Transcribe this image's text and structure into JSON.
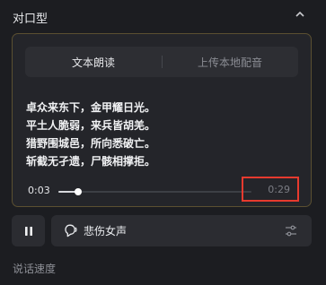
{
  "section": {
    "title": "对口型",
    "collapse_icon": "chevron-up-icon"
  },
  "tabs": [
    {
      "label": "文本朗读",
      "active": true
    },
    {
      "label": "上传本地配音",
      "active": false
    }
  ],
  "poem": {
    "lines": [
      "卓众来东下，金甲耀日光。",
      "平土人脆弱，来兵皆胡羌。",
      "猎野围城邑，所向悉破亡。",
      "斩截无孑遗，尸骸相撑拒。"
    ]
  },
  "player": {
    "current_time": "0:03",
    "total_time": "0:29",
    "progress_fraction": 0.1034
  },
  "controls": {
    "pause_icon": "pause-icon",
    "voice_icon": "voice-speech-icon",
    "voice_label": "悲伤女声",
    "settings_icon": "sliders-icon"
  },
  "footer": {
    "label": "说话速度"
  },
  "colors": {
    "background": "#1c1d21",
    "card_border": "#5b5031",
    "highlight_box": "#e83a2e"
  }
}
